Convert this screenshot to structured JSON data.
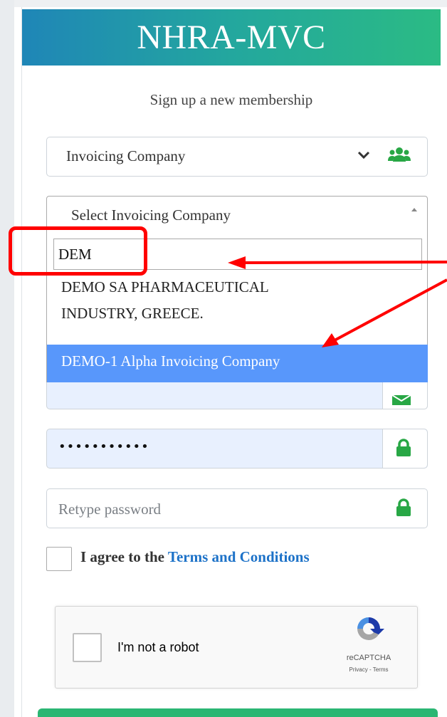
{
  "header": {
    "title": "NHRA-MVC"
  },
  "subtitle": "Sign up a new membership",
  "company_type_select": {
    "value": "Invoicing Company"
  },
  "company_select": {
    "value": "Select Invoicing Company",
    "search_value": "DEM",
    "options": [
      {
        "label_line1": "DEMO SA PHARMACEUTICAL",
        "label_line2": "INDUSTRY, GREECE."
      },
      {
        "label": "DEMO-1 Alpha Invoicing Company",
        "highlighted": true
      }
    ]
  },
  "password": {
    "masked_value": "•••••••••••"
  },
  "retype_password": {
    "placeholder": "Retype password"
  },
  "agree": {
    "prefix": "I agree to the ",
    "link": "Terms and Conditions"
  },
  "recaptcha": {
    "label": "I'm not a robot",
    "brand": "reCAPTCHA",
    "links": "Privacy - Terms"
  },
  "colors": {
    "header_gradient_start": "#1f86b7",
    "header_gradient_end": "#2bbb84",
    "highlight": "#5897fb",
    "annotation": "#ff0000",
    "lock_icon": "#28a745",
    "link": "#1d72c8"
  },
  "icons": [
    "chevron-down-icon",
    "users-icon",
    "envelope-icon",
    "lock-icon",
    "recaptcha-logo-icon"
  ]
}
